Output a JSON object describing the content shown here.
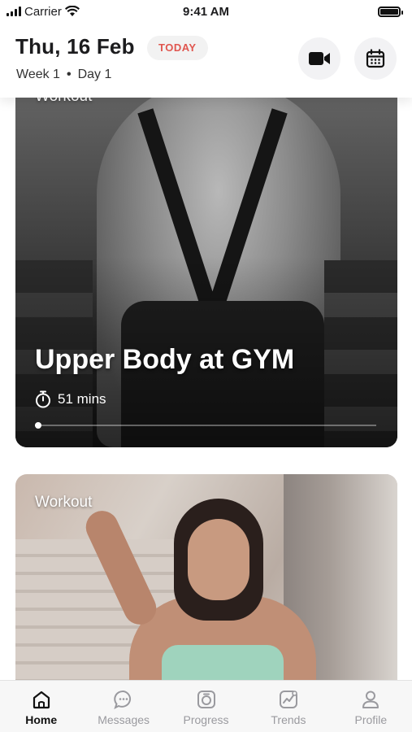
{
  "status_bar": {
    "carrier": "Carrier",
    "time": "9:41 AM"
  },
  "header": {
    "date": "Thu, 16 Feb",
    "today_badge": "TODAY",
    "week": "Week 1",
    "separator": "•",
    "day": "Day 1",
    "icons": [
      "video-camera-icon",
      "calendar-icon"
    ]
  },
  "cards": [
    {
      "label": "Workout",
      "title": "Upper Body at GYM",
      "duration": "51 mins",
      "progress": 0.01
    },
    {
      "label": "Workout"
    }
  ],
  "tabs": [
    {
      "label": "Home",
      "icon": "home-icon",
      "active": true
    },
    {
      "label": "Messages",
      "icon": "chat-bubble-icon",
      "active": false
    },
    {
      "label": "Progress",
      "icon": "progress-icon",
      "active": false
    },
    {
      "label": "Trends",
      "icon": "trends-chart-icon",
      "active": false
    },
    {
      "label": "Profile",
      "icon": "user-icon",
      "active": false
    }
  ],
  "colors": {
    "accent": "#e0564f",
    "active_tab": "#111111",
    "inactive_tab": "#9a9a9f"
  }
}
